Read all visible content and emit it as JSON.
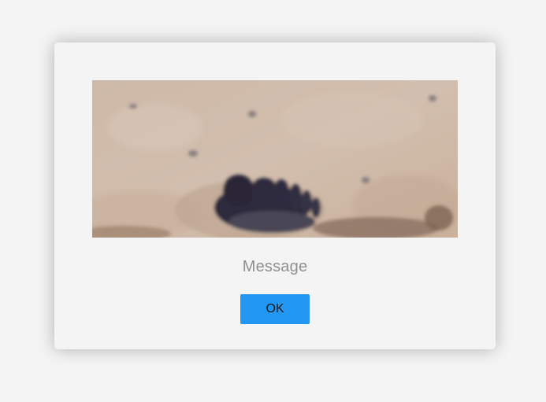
{
  "dialog": {
    "image_name": "footprint-in-sand",
    "message": "Message",
    "ok_label": "OK"
  },
  "colors": {
    "page_background": "#f4f4f4",
    "dialog_background": "#f4f4f4",
    "message_text": "#8f8f8f",
    "button_background": "#2196f3",
    "button_text": "#1a1a1a"
  }
}
